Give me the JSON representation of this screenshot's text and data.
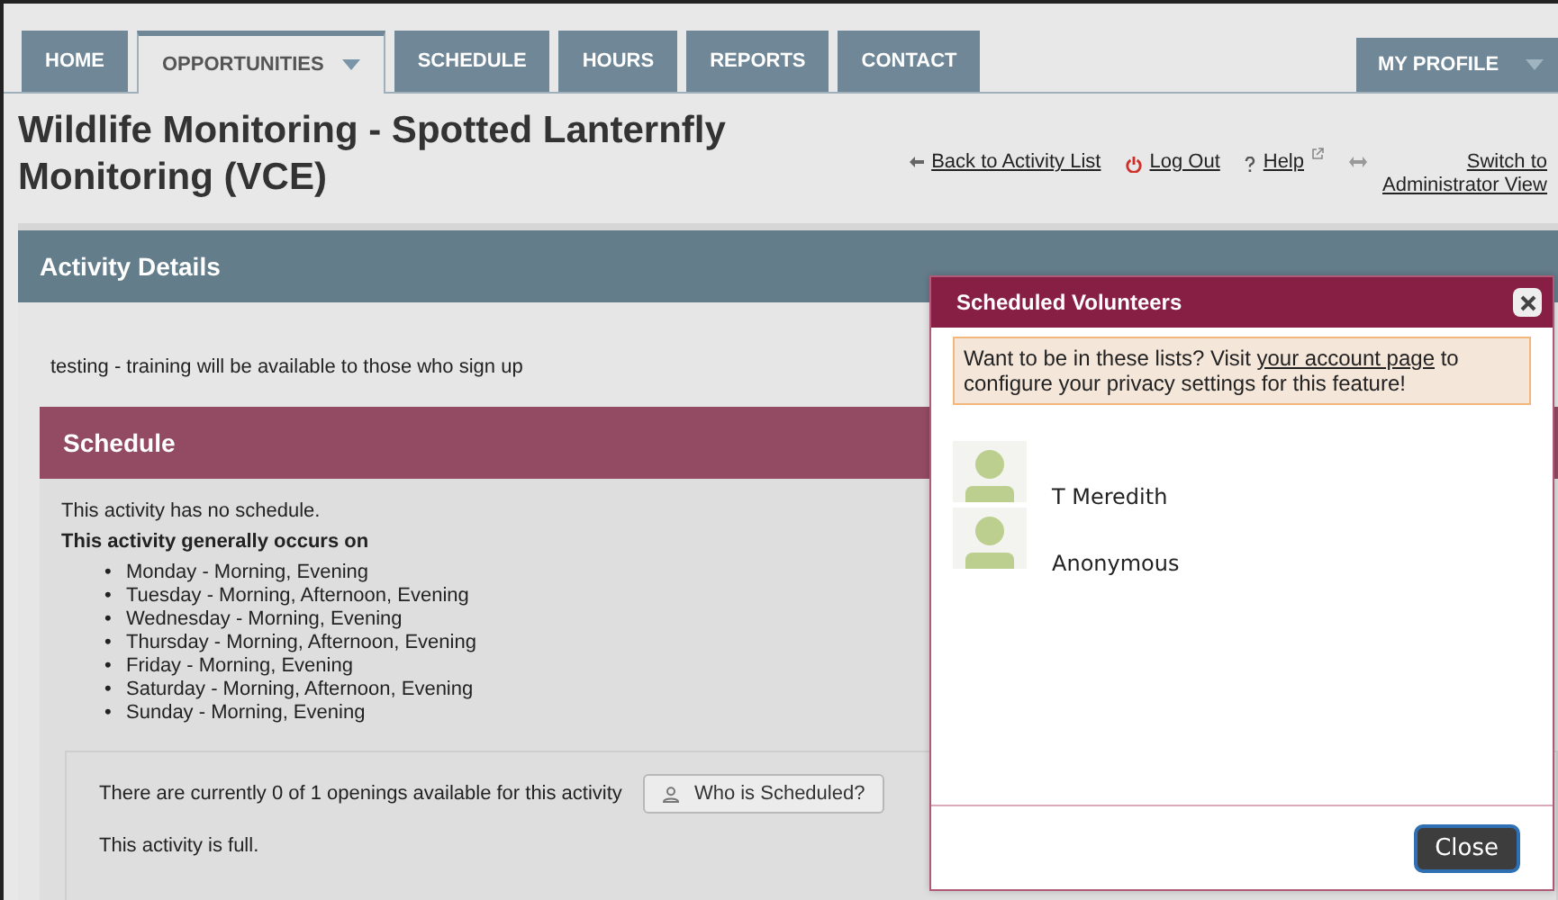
{
  "nav": {
    "tabs": [
      {
        "label": "HOME",
        "selected": false,
        "dropdown": false
      },
      {
        "label": "OPPORTUNITIES",
        "selected": true,
        "dropdown": true
      },
      {
        "label": "SCHEDULE",
        "selected": false,
        "dropdown": false
      },
      {
        "label": "HOURS",
        "selected": false,
        "dropdown": false
      },
      {
        "label": "REPORTS",
        "selected": false,
        "dropdown": false
      },
      {
        "label": "CONTACT",
        "selected": false,
        "dropdown": false
      }
    ],
    "profile": {
      "label": "MY PROFILE",
      "dropdown": true
    }
  },
  "page_title": "Wildlife Monitoring - Spotted Lanternfly Monitoring (VCE)",
  "header_links": [
    {
      "kind": "back",
      "label": "Back to Activity List"
    },
    {
      "kind": "logout",
      "label": "Log Out"
    },
    {
      "kind": "help",
      "label": "Help"
    },
    {
      "kind": "switch",
      "label": "Switch to Administrator View"
    }
  ],
  "activity_details": {
    "title": "Activity Details",
    "description": "testing - training will be available to those who sign up"
  },
  "schedule": {
    "title": "Schedule",
    "no_schedule": "This activity has no schedule.",
    "occurs_heading": "This activity generally occurs on",
    "bullet": "•",
    "days": [
      "Monday - Morning, Evening",
      "Tuesday - Morning, Afternoon, Evening",
      "Wednesday - Morning, Evening",
      "Thursday - Morning, Afternoon, Evening",
      "Friday - Morning, Evening",
      "Saturday - Morning, Afternoon, Evening",
      "Sunday - Morning, Evening"
    ],
    "openings": "There are currently 0 of 1 openings available for this activity",
    "who_button": "Who is Scheduled?",
    "status": "This activity is full."
  },
  "dialog": {
    "title": "Scheduled Volunteers",
    "notice": {
      "before": "Want to be in these lists? Visit ",
      "link": "your account page",
      "after": " to configure your privacy settings for this feature!"
    },
    "volunteers": [
      {
        "name": "T Meredith"
      },
      {
        "name": "Anonymous"
      }
    ],
    "close_button": "Close"
  }
}
